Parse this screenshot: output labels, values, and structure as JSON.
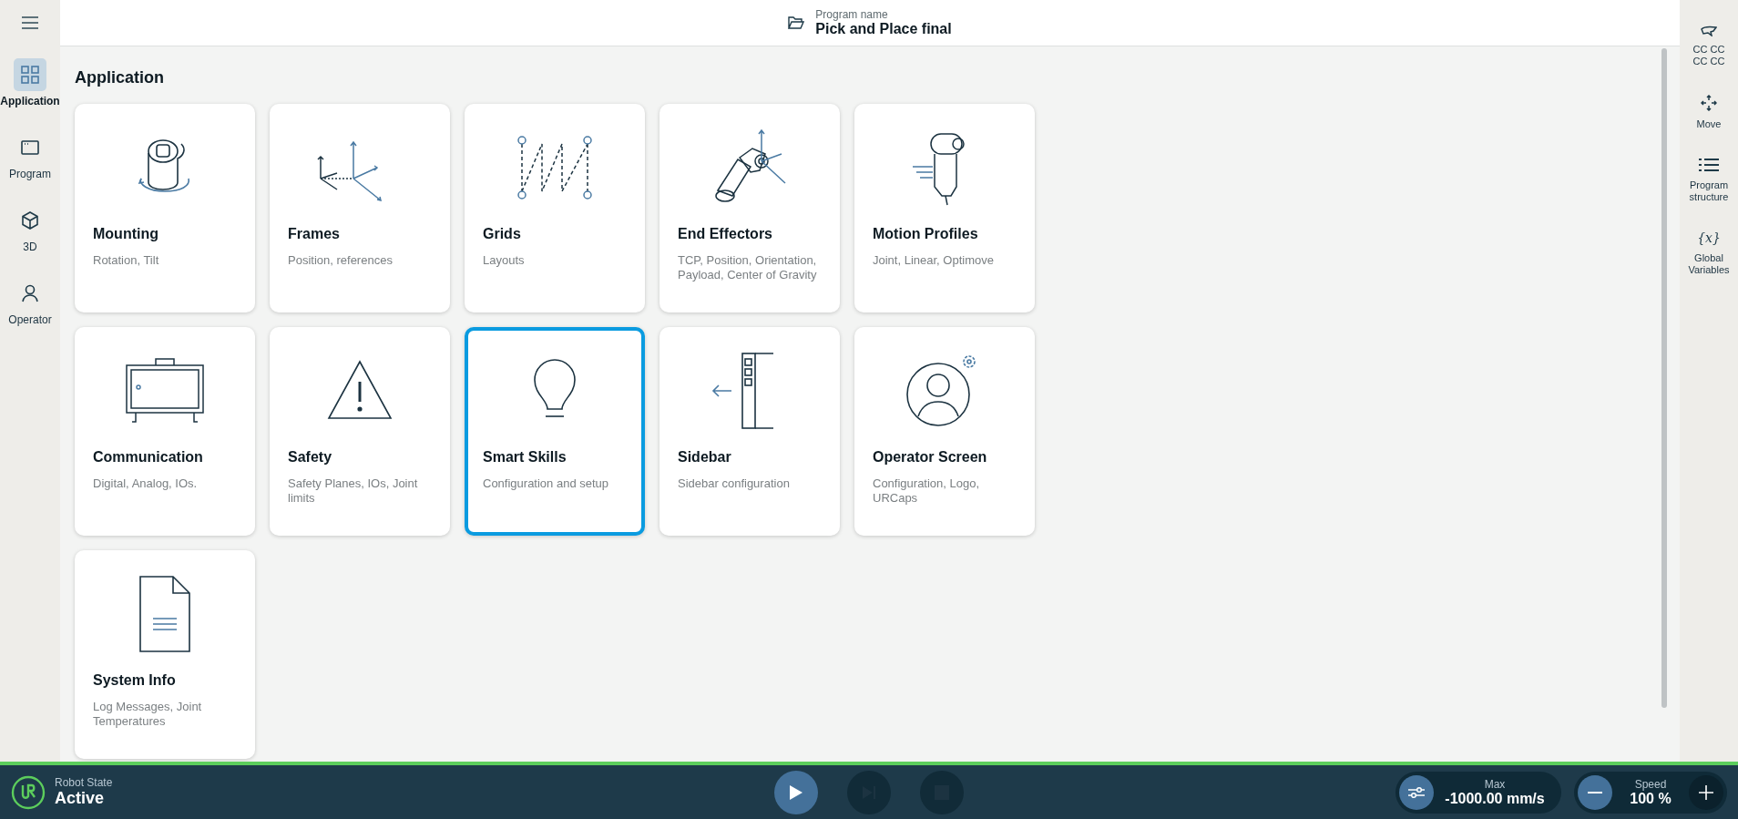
{
  "left_nav": {
    "items": [
      {
        "label": "Application",
        "selected": true
      },
      {
        "label": "Program",
        "selected": false
      },
      {
        "label": "3D",
        "selected": false
      },
      {
        "label": "Operator",
        "selected": false
      }
    ]
  },
  "header": {
    "label": "Program name",
    "program": "Pick and Place final"
  },
  "section_title": "Application",
  "cards": [
    {
      "title": "Mounting",
      "description": "Rotation, Tilt",
      "selected": false
    },
    {
      "title": "Frames",
      "description": "Position, references",
      "selected": false
    },
    {
      "title": "Grids",
      "description": "Layouts",
      "selected": false
    },
    {
      "title": "End Effectors",
      "description": "TCP, Position, Orientation, Payload, Center of Gravity",
      "selected": false
    },
    {
      "title": "Motion Profiles",
      "description": "Joint, Linear, Optimove",
      "selected": false
    },
    {
      "title": "Communication",
      "description": "Digital, Analog, IOs.",
      "selected": false
    },
    {
      "title": "Safety",
      "description": "Safety Planes, IOs, Joint limits",
      "selected": false
    },
    {
      "title": "Smart Skills",
      "description": "Configuration and setup",
      "selected": true
    },
    {
      "title": "Sidebar",
      "description": "Sidebar configuration",
      "selected": false
    },
    {
      "title": "Operator Screen",
      "description": "Configuration, Logo, URCaps",
      "selected": false
    },
    {
      "title": "System Info",
      "description": "Log Messages, Joint Temperatures",
      "selected": false
    }
  ],
  "right_nav": {
    "items": [
      {
        "label": "CC CC CC CC"
      },
      {
        "label": "Move"
      },
      {
        "label": "Program structure"
      },
      {
        "label": "Global Variables",
        "icon": "{x}"
      }
    ]
  },
  "status_bar": {
    "robot_state_label": "Robot State",
    "robot_state": "Active",
    "max_label": "Max",
    "max_value": "-1000.00 mm/s",
    "speed_label": "Speed",
    "speed_value": "100 %"
  }
}
